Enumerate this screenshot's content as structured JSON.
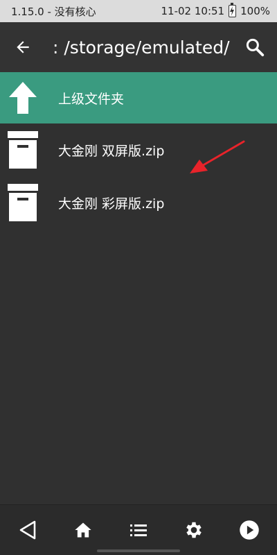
{
  "status_bar": {
    "left_text": "1.15.0 - 没有核心",
    "time": "11-02 10:51",
    "battery": "100%"
  },
  "toolbar": {
    "path": ": /storage/emulated/",
    "back_icon": "arrow-left-icon",
    "search_icon": "search-icon"
  },
  "list": {
    "parent": {
      "label": "上级文件夹",
      "icon": "arrow-up-icon"
    },
    "files": [
      {
        "name": "大金刚 双屏版.zip",
        "icon": "archive-box-icon"
      },
      {
        "name": "大金刚 彩屏版.zip",
        "icon": "archive-box-icon"
      }
    ]
  },
  "bottom_nav": {
    "items": [
      "triangle-back-icon",
      "home-icon",
      "list-icon",
      "gear-icon",
      "play-circle-icon"
    ]
  },
  "colors": {
    "accent": "#3a9b80",
    "background": "#303030",
    "annotation": "#e8232a"
  }
}
